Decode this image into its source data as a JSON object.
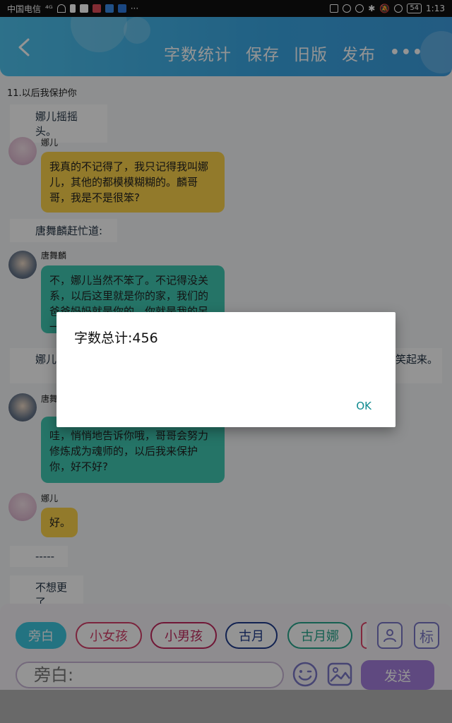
{
  "statusbar": {
    "carrier": "中国电信",
    "signal": "⁴ᴳ",
    "battery": "54",
    "time": "1:13"
  },
  "header": {
    "actions": [
      "字数统计",
      "保存",
      "旧版",
      "发布"
    ],
    "more": "•••"
  },
  "chapter_title": "11.以后我保护你",
  "messages": {
    "narr1": "娜儿摇摇头。",
    "name1": "娜儿",
    "bubble1": "我真的不记得了，我只记得我叫娜儿，其他的都模模糊糊的。麟哥哥，我是不是很笨?",
    "narr2": "唐舞麟赶忙道:",
    "name2": "唐舞麟",
    "bubble2": "不，娜儿当然不笨了。不记得没关系，以后这里就是你的家，我们的爸爸妈妈就是你的，你就是我的另一",
    "narr3": "娜儿",
    "narr3_tail": "次笑起来。",
    "name3": "唐舞",
    "bubble3": "哇，悄悄地告诉你哦，哥哥会努力修炼成为魂师的，以后我来保护你，好不好?",
    "name4": "娜儿",
    "bubble4": "好。",
    "narr4": "-----",
    "narr5": "不想更了"
  },
  "dialog": {
    "title": "字数总计:456",
    "ok": "OK"
  },
  "roles": [
    {
      "label": "旁白",
      "color": "#3dc7df",
      "active": true
    },
    {
      "label": "小女孩",
      "color": "#d43f6a"
    },
    {
      "label": "小男孩",
      "color": "#c2285e"
    },
    {
      "label": "古月",
      "color": "#1f3c8c"
    },
    {
      "label": "古月娜",
      "color": "#26a58c"
    }
  ],
  "toolbar": {
    "tag_label": "标",
    "input_value": "旁白:",
    "send_label": "发送"
  },
  "colors": {
    "header": "#3aa7e4",
    "bubble_yellow": "#fbd24a",
    "bubble_teal": "#40c8b2",
    "send": "#a47fdc",
    "accent_purple": "#7a77c7"
  }
}
